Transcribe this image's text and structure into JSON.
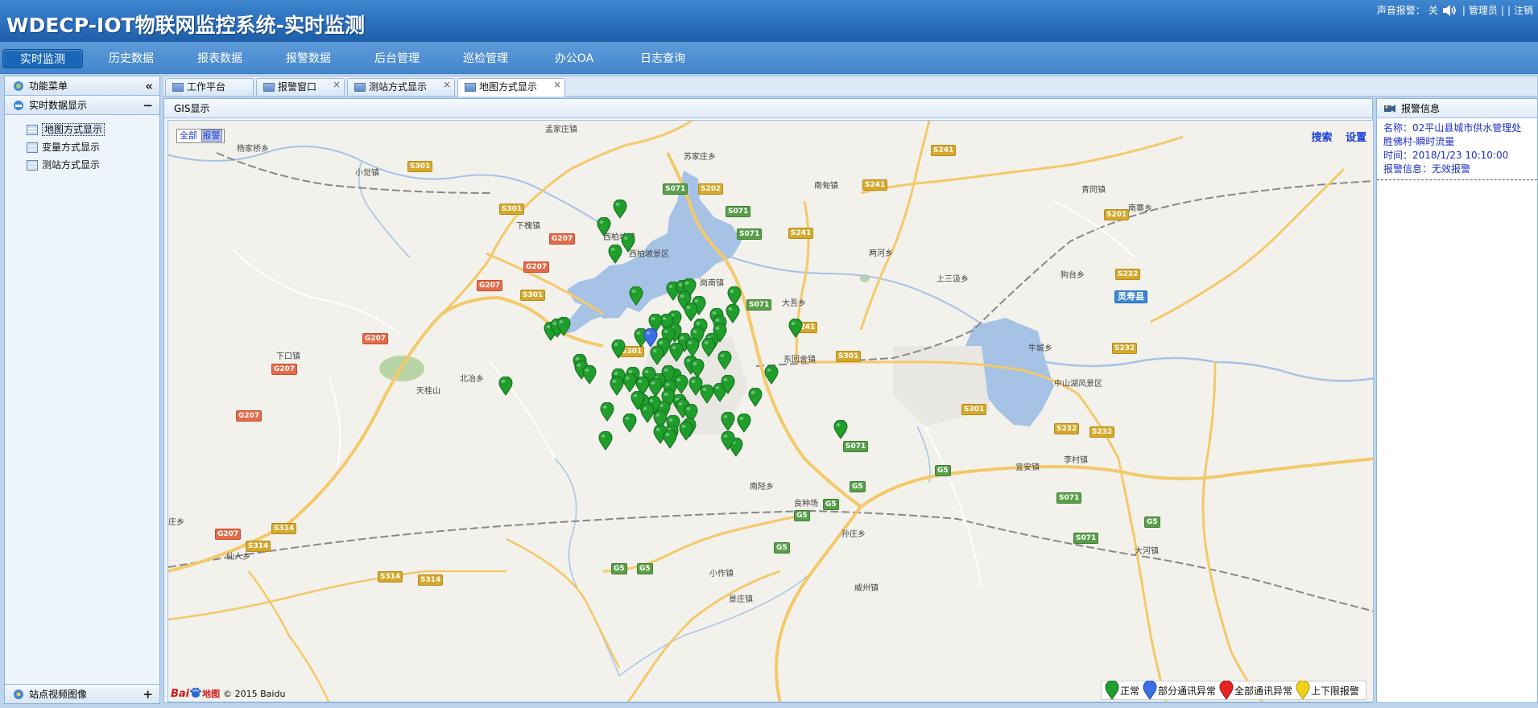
{
  "app": {
    "title": "WDECP-IOT物联网监控系统-实时监测",
    "sound_alarm_label": "声音报警：",
    "sound_alarm_state": "关",
    "user_label": "管理员",
    "logout_label": "注销"
  },
  "nav": {
    "items": [
      "实时监测",
      "历史数据",
      "报表数据",
      "报警数据",
      "后台管理",
      "巡检管理",
      "办公OA",
      "日志查询"
    ],
    "active": "实时监测"
  },
  "sidebar": {
    "header": "功能菜单",
    "collapse_symbol": "«",
    "section": "实时数据显示",
    "section_toggle": "−",
    "items": [
      "地图方式显示",
      "变量方式显示",
      "测站方式显示"
    ],
    "selected": "地图方式显示",
    "bottom_section": "站点视频图像",
    "bottom_toggle": "+"
  },
  "tabs": {
    "items": [
      "工作平台",
      "报警窗口",
      "测站方式显示",
      "地图方式显示"
    ],
    "active": "地图方式显示",
    "close_symbol": "×"
  },
  "gis": {
    "title": "GIS显示",
    "filter_all": "全部",
    "filter_alarm": "报警",
    "search_label": "搜索",
    "settings_label": "设置",
    "copyright": "© 2015 Baidu",
    "logo_text": "Bai",
    "logo_map": "地图",
    "places": [
      "孟家庄镇",
      "杨家桥乡",
      "小觉镇",
      "苏家庄乡",
      "下槐镇",
      "西柏坡镇",
      "西柏坡景区",
      "岗南镇",
      "南甸镇",
      "两河乡",
      "上三汲乡",
      "狗台乡",
      "青同镇",
      "南寨乡",
      "灵寿县",
      "大吾乡",
      "下口镇",
      "北冶乡",
      "天桂山",
      "东回舍镇",
      "牛城乡",
      "中山湖风景区",
      "宜安镇",
      "李村镇",
      "南陉乡",
      "良种场",
      "孙庄乡",
      "小作镇",
      "威州镇",
      "景庄镇",
      "仙人乡",
      "大河镇",
      "庄乡"
    ],
    "roads": [
      "S301",
      "S202",
      "S071",
      "S241",
      "S232",
      "S201",
      "G207",
      "G5",
      "S314",
      "S071"
    ],
    "legend": [
      "正常",
      "部分通讯异常",
      "全部通讯异常",
      "上下限报警"
    ],
    "legend_colors": [
      "#1f9e2c",
      "#3a6fe6",
      "#e62424",
      "#f0d21a"
    ]
  },
  "alarm": {
    "title": "报警信息",
    "name_line": "名称：02平山县城市供水管理处胜佛村-瞬时流量",
    "time_line": "时间：2018/1/23 10:10:00",
    "info_line": "报警信息：无效报警"
  }
}
